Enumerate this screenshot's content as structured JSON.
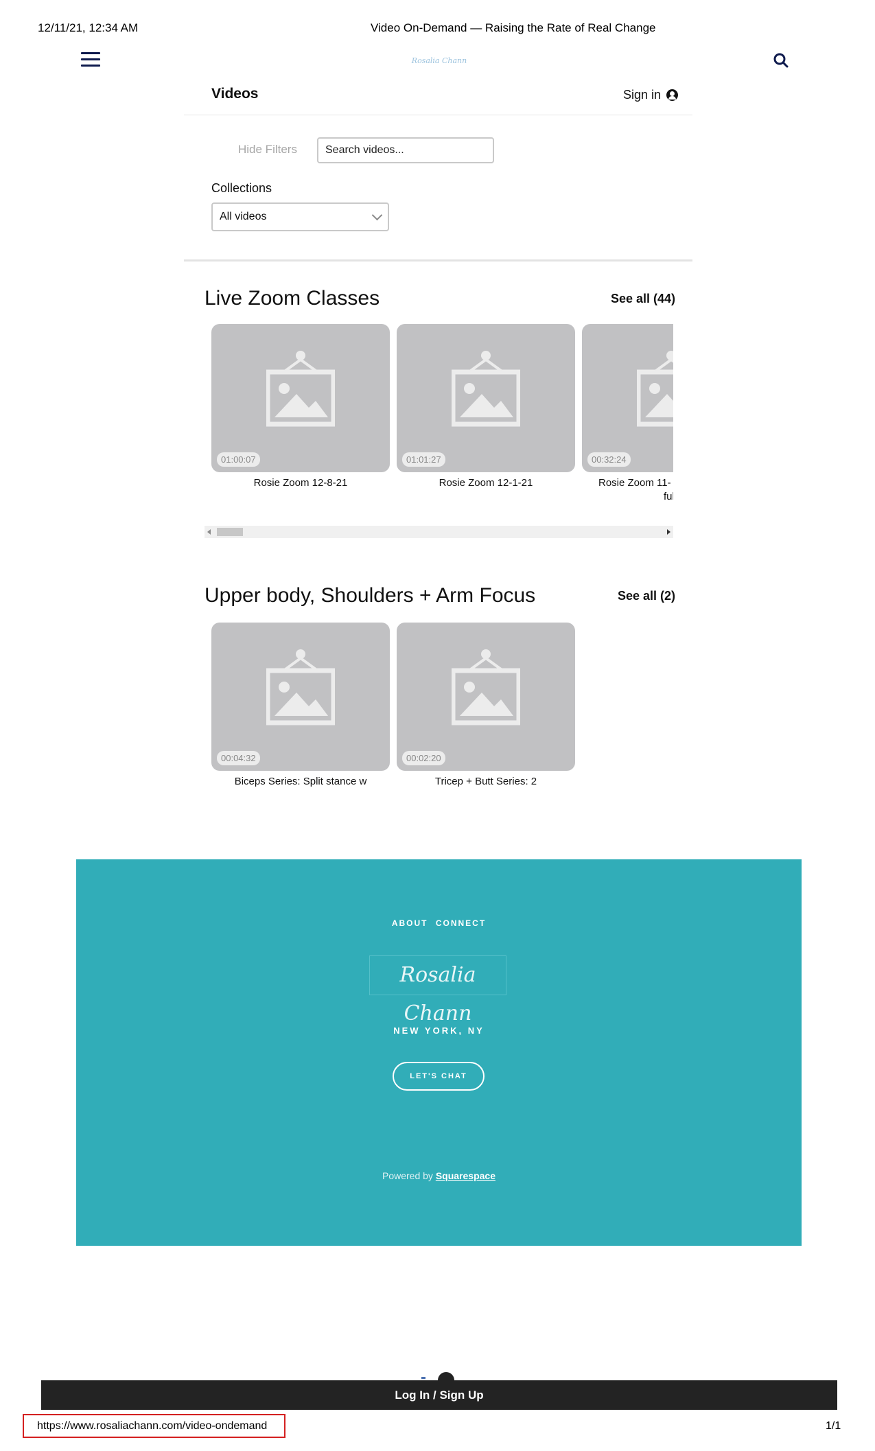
{
  "print_header": {
    "datetime": "12/11/21, 12:34 AM",
    "page_title": "Video On-Demand — Raising the Rate of Real Change"
  },
  "nav": {
    "brand": "Rosalia Chann",
    "menu_icon": "hamburger-menu-icon",
    "search_icon": "search-icon"
  },
  "videos_header": {
    "title": "Videos",
    "sign_in": "Sign in",
    "user_icon": "user-circle-icon"
  },
  "filters": {
    "hide_filters": "Hide Filters",
    "search_placeholder": "Search videos...",
    "collections_label": "Collections",
    "collection_selected": "All videos"
  },
  "sections": [
    {
      "title": "Live Zoom Classes",
      "see_all": "See all (44)",
      "videos": [
        {
          "duration": "01:00:07",
          "title": "Rosie Zoom 12-8-21"
        },
        {
          "duration": "01:01:27",
          "title": "Rosie Zoom 12-1-21"
        },
        {
          "duration": "00:32:24",
          "title": "Rosie Zoom 11-",
          "title_line2": "full bo"
        }
      ]
    },
    {
      "title": "Upper body, Shoulders + Arm Focus",
      "see_all": "See all (2)",
      "videos": [
        {
          "duration": "00:04:32",
          "title": "Biceps Series: Split stance w"
        },
        {
          "duration": "00:02:20",
          "title": "Tricep + Butt Series: 2"
        }
      ]
    }
  ],
  "footer": {
    "links": [
      "ABOUT",
      "CONNECT"
    ],
    "logo_text": "Rosalia Chann",
    "location": "NEW YORK, NY",
    "cta": "LET'S CHAT",
    "powered_prefix": "Powered by",
    "powered_link": "Squarespace",
    "background": "#31adb8"
  },
  "login_bar": "Log In / Sign Up",
  "print_footer": {
    "url": "https://www.rosaliachann.com/video-ondemand",
    "page": "1/1"
  }
}
